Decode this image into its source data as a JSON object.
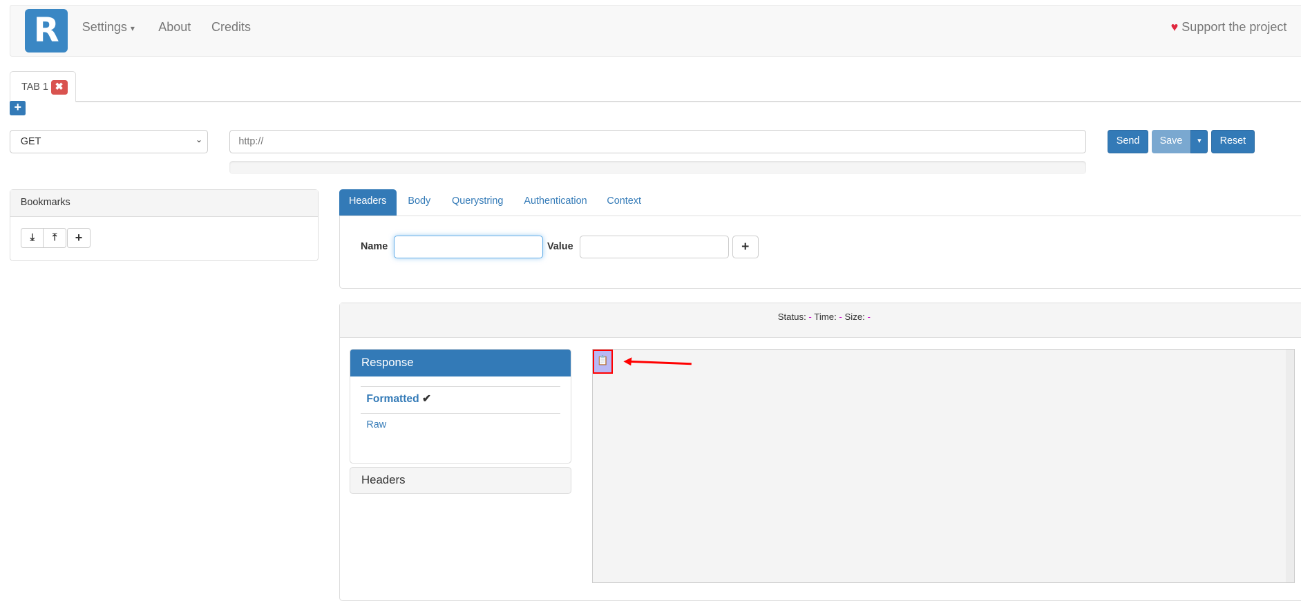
{
  "navbar": {
    "logo": "R",
    "items": [
      "Settings",
      "About",
      "Credits"
    ],
    "settings_caret": "▾",
    "support": "Support the project",
    "heart": "♥"
  },
  "tabs": {
    "items": [
      {
        "label": "TAB 1",
        "close": "✖"
      }
    ],
    "add": "+"
  },
  "request": {
    "method": "GET",
    "url_placeholder": "http://",
    "send": "Send",
    "save": "Save",
    "save_caret": "▾",
    "reset": "Reset"
  },
  "bookmarks": {
    "title": "Bookmarks",
    "import_icon": "⤓",
    "export_icon": "⤒",
    "add": "+"
  },
  "request_tabs": {
    "items": [
      "Headers",
      "Body",
      "Querystring",
      "Authentication",
      "Context"
    ],
    "active": "Headers"
  },
  "headers_form": {
    "name_label": "Name",
    "value_label": "Value",
    "name_value": "",
    "value_value": "",
    "add": "+"
  },
  "status_bar": {
    "status_label": "Status:",
    "status": "-",
    "time_label": "Time:",
    "time": "-",
    "size_label": "Size:",
    "size": "-"
  },
  "response": {
    "title": "Response",
    "formatted": "Formatted",
    "check": "✔",
    "raw": "Raw",
    "headers": "Headers",
    "copy_icon": "clipboard-icon"
  },
  "colors": {
    "primary": "#337ab7",
    "danger": "#d9534f",
    "annotation": "#ff0000"
  }
}
